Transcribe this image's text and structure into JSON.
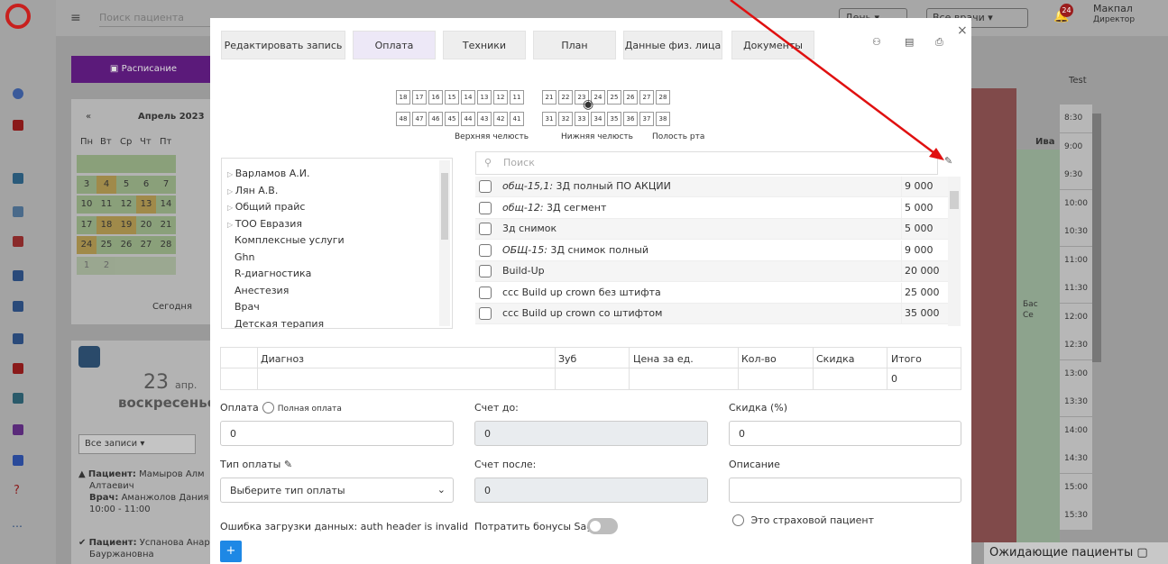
{
  "topbar": {
    "search_placeholder": "Поиск пациента",
    "day_select": "День",
    "doctor_select": "Все врачи",
    "notif_count": "24",
    "user_name": "Макпал",
    "user_role": "Директор"
  },
  "sidebar_left": {
    "schedule_button": "Расписание",
    "calendar": {
      "prev": "«",
      "month": "Апрель 2023",
      "dow": [
        "Пн",
        "Вт",
        "Ср",
        "Чт",
        "Пт"
      ],
      "rows": [
        [
          "",
          "",
          "",
          "",
          ""
        ],
        [
          "3",
          "4",
          "5",
          "6",
          "7"
        ],
        [
          "10",
          "11",
          "12",
          "13",
          "14"
        ],
        [
          "17",
          "18",
          "19",
          "20",
          "21"
        ],
        [
          "24",
          "25",
          "26",
          "27",
          "28"
        ],
        [
          "1",
          "2",
          "",
          "",
          ""
        ]
      ],
      "today": "Сегодня"
    },
    "date_card": {
      "day": "23",
      "month_abbr": "апр.",
      "weekday": "воскресенье",
      "filter": "Все записи",
      "appointments": [
        {
          "patient_label": "Пациент:",
          "patient": "Мамыров Алм",
          "patient2": "Алтаевич",
          "doctor_label": "Врач:",
          "doctor": "Аманжолов Дания",
          "time": "10:00 - 11:00"
        },
        {
          "patient_label": "Пациент:",
          "patient": "Успанова Анар",
          "patient2": "Бауржановна"
        }
      ]
    }
  },
  "schedule": {
    "col_header": "Test",
    "col2": "Ива",
    "times": [
      "8:30",
      "9:00",
      "9:30",
      "10:00",
      "10:30",
      "11:00",
      "11:30",
      "12:00",
      "12:30",
      "13:00",
      "13:30",
      "14:00",
      "14:30",
      "15:00",
      "15:30"
    ],
    "appt_text": "Бас",
    "appt_text2": "Се",
    "waiting": "Ожидающие пациенты"
  },
  "modal": {
    "tabs": [
      "Редактировать запись",
      "Оплата",
      "Техники",
      "План",
      "Данные физ. лица",
      "Документы"
    ],
    "teeth_upper": [
      "18",
      "17",
      "16",
      "15",
      "14",
      "13",
      "12",
      "11",
      "21",
      "22",
      "23",
      "24",
      "25",
      "26",
      "27",
      "28"
    ],
    "teeth_lower": [
      "48",
      "47",
      "46",
      "45",
      "44",
      "43",
      "42",
      "41",
      "31",
      "32",
      "33",
      "34",
      "35",
      "36",
      "37",
      "38"
    ],
    "jaw_labels": [
      "Верхняя челюсть",
      "Нижняя челюсть",
      "Полость рта"
    ],
    "tree": [
      "Варламов А.И.",
      "Лян А.В.",
      "Общий прайс",
      "ТОО Евразия",
      "Комплексные услуги",
      "Ghn",
      "R-диагностика",
      "Анестезия",
      "Врач",
      "Детская терапия"
    ],
    "search_placeholder": "Поиск",
    "services": [
      {
        "code": "общ-15,1:",
        "name": "3Д полный ПО АКЦИИ",
        "price": "9 000"
      },
      {
        "code": "общ-12:",
        "name": "3Д сегмент",
        "price": "5 000"
      },
      {
        "code": "",
        "name": "3д снимок",
        "price": "5 000"
      },
      {
        "code": "ОБЩ-15:",
        "name": "3Д снимок полный",
        "price": "9 000"
      },
      {
        "code": "",
        "name": "Build-Up",
        "price": "20 000"
      },
      {
        "code": "",
        "name": "ccc Build up crown без штифта",
        "price": "25 000"
      },
      {
        "code": "",
        "name": "ccc Build up crown со штифтом",
        "price": "35 000"
      }
    ],
    "table_headers": [
      "Диагноз",
      "Зуб",
      "Цена за ед.",
      "Кол-во",
      "Скидка",
      "Итого"
    ],
    "table_total": "0",
    "payment": {
      "label": "Оплата",
      "full_label": "Полная оплата",
      "value": "0"
    },
    "bill_before": {
      "label": "Счет до:",
      "value": "0"
    },
    "discount": {
      "label": "Скидка (%)",
      "value": "0"
    },
    "pay_type": {
      "label": "Тип оплаты",
      "value": "Выберите тип оплаты"
    },
    "bill_after": {
      "label": "Счет после:",
      "value": "0"
    },
    "description": {
      "label": "Описание",
      "value": ""
    },
    "error": "Ошибка загрузки данных: auth header is invalid",
    "bonus": "Потратить бонусы Sagi",
    "insurance": "Это страховой пациент",
    "add": "+"
  }
}
